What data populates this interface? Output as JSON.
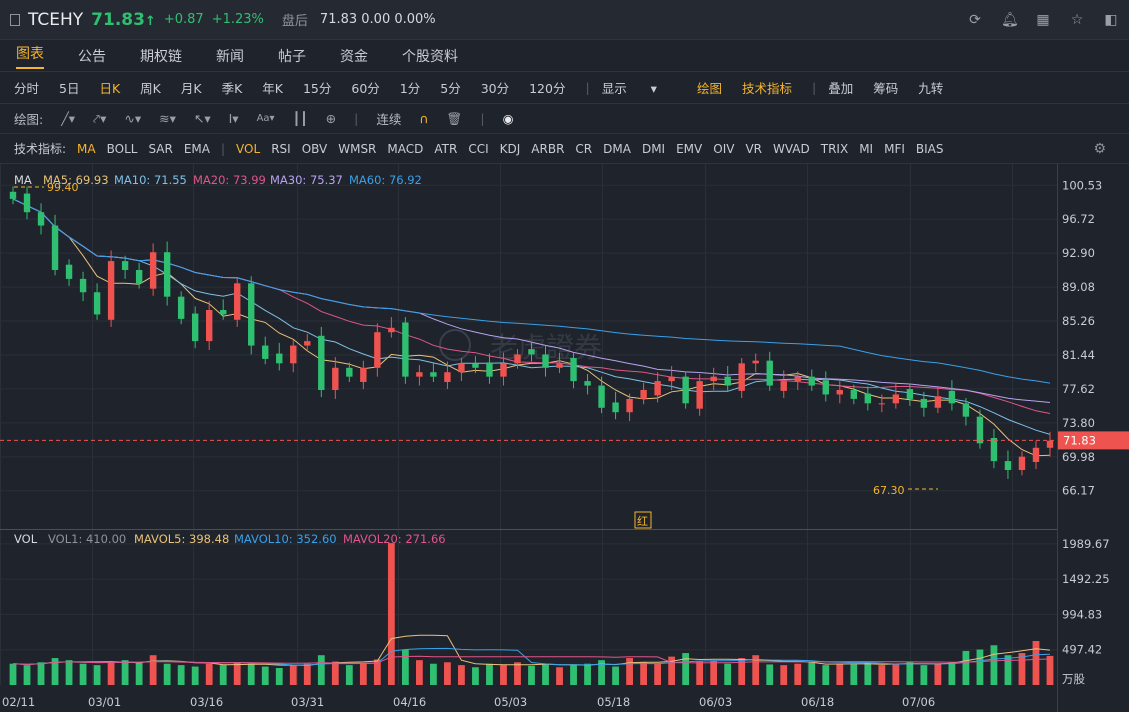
{
  "header": {
    "symbol": "TCEHY",
    "price": "71.83",
    "arrow": "↑",
    "change": "+0.87",
    "change_pct": "+1.23%",
    "after_hours_label": "盘后",
    "after_hours_value": "71.83 0.00 0.00%"
  },
  "tabs": [
    "图表",
    "公告",
    "期权链",
    "新闻",
    "帖子",
    "资金",
    "个股资料"
  ],
  "periods": [
    "分时",
    "5日",
    "日K",
    "周K",
    "月K",
    "季K",
    "年K",
    "15分",
    "60分",
    "1分",
    "5分",
    "30分",
    "120分"
  ],
  "period_options": {
    "display": "显示",
    "draw": "绘图",
    "indicators": "技术指标",
    "overlay": "叠加",
    "chips": "筹码",
    "nine": "九转"
  },
  "draw_bar": {
    "label": "绘图:",
    "continuous": "连续"
  },
  "indicator_bar": {
    "label": "技术指标:",
    "main": [
      "MA",
      "BOLL",
      "SAR",
      "EMA"
    ],
    "sub": [
      "VOL",
      "RSI",
      "OBV",
      "WMSR",
      "MACD",
      "ATR",
      "CCI",
      "KDJ",
      "ARBR",
      "CR",
      "DMA",
      "DMI",
      "EMV",
      "OIV",
      "VR",
      "WVAD",
      "TRIX",
      "MI",
      "MFI",
      "BIAS"
    ]
  },
  "ma_legend": {
    "label": "MA",
    "ma5": "MA5: 69.93",
    "ma10": "MA10: 71.55",
    "ma20": "MA20: 73.99",
    "ma30": "MA30: 75.37",
    "ma60": "MA60: 76.92"
  },
  "vol_legend": {
    "label": "VOL",
    "vol1": "VOL1: 410.00",
    "mavol5": "MAVOL5: 398.48",
    "mavol10": "MAVOL10: 352.60",
    "mavol20": "MAVOL20: 271.66"
  },
  "colors": {
    "up": "#ef5350",
    "down": "#2fbf71",
    "ma5": "#e8c27a",
    "ma10": "#7ec0e8",
    "ma20": "#e0568a",
    "ma30": "#b7a3f0",
    "ma60": "#3aa0e8",
    "accent": "#f5b52c"
  },
  "watermark": "老虎證券",
  "marker": "红",
  "chart_data": {
    "type": "candlestick",
    "price_axis": [
      "100.53",
      "96.72",
      "92.90",
      "89.08",
      "85.26",
      "81.44",
      "77.62",
      "73.80",
      "69.98",
      "66.17"
    ],
    "current_price_label": "71.83",
    "high_annotation": "99.40",
    "low_annotation": "67.30",
    "volume_axis": [
      "1989.67",
      "1492.25",
      "994.83",
      "497.42"
    ],
    "volume_unit": "万股",
    "x_labels": [
      "02/11",
      "03/01",
      "03/16",
      "03/31",
      "04/16",
      "05/03",
      "05/18",
      "06/03",
      "06/18",
      "07/06"
    ],
    "ylim": [
      64.9,
      101.8
    ],
    "vol_max": 2100,
    "closes": [
      99.0,
      97.5,
      96.0,
      91.0,
      90.0,
      88.5,
      86.0,
      92.0,
      91.0,
      89.5,
      93.0,
      88.0,
      85.5,
      83.0,
      86.5,
      86.0,
      89.5,
      82.5,
      81.0,
      80.5,
      82.5,
      83.0,
      77.5,
      80.0,
      79.0,
      80.0,
      84.0,
      84.5,
      79.0,
      79.5,
      79.0,
      79.5,
      80.5,
      80.0,
      79.0,
      80.5,
      81.5,
      81.5,
      80.0,
      80.5,
      78.5,
      78.0,
      75.5,
      75.0,
      76.5,
      77.5,
      78.5,
      79.0,
      76.0,
      78.5,
      79.0,
      78.0,
      80.5,
      80.8,
      78.0,
      78.5,
      79.0,
      78.0,
      77.0,
      77.5,
      76.5,
      76.0,
      76.0,
      77.0,
      76.5,
      75.5,
      76.8,
      76.0,
      74.5,
      71.5,
      69.5,
      68.5,
      70.0,
      71.0,
      71.8
    ],
    "volumes": [
      300,
      280,
      320,
      380,
      350,
      300,
      280,
      330,
      350,
      310,
      420,
      300,
      280,
      260,
      300,
      280,
      320,
      300,
      260,
      240,
      280,
      300,
      420,
      330,
      280,
      300,
      360,
      2000,
      500,
      350,
      300,
      320,
      280,
      250,
      300,
      280,
      320,
      270,
      300,
      250,
      280,
      300,
      350,
      260,
      380,
      320,
      300,
      400,
      450,
      330,
      340,
      300,
      380,
      420,
      290,
      280,
      300,
      320,
      280,
      300,
      290,
      310,
      280,
      300,
      330,
      280,
      300,
      320,
      480,
      500,
      560,
      420,
      450,
      620,
      410
    ]
  }
}
